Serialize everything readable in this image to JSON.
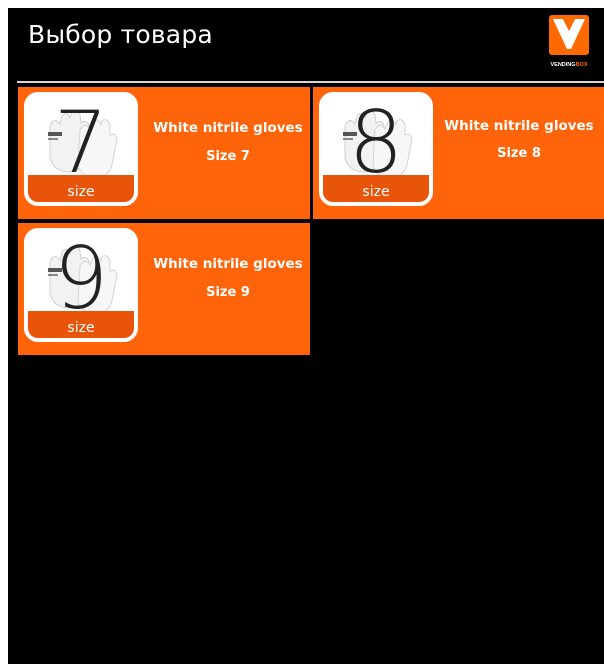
{
  "header": {
    "title": "Выбор товара",
    "logo": {
      "icon": "vendingbox-logo-icon",
      "text_primary": "VENDING",
      "text_accent": "BOX",
      "accent_color": "#ff6a00"
    }
  },
  "colors": {
    "background": "#000000",
    "card": "#ff640a",
    "card_band": "#e8550a",
    "text": "#ffffff"
  },
  "products": [
    {
      "size_number": "7",
      "size_word": "size",
      "name": "White nitrile gloves",
      "size_label": "Size 7",
      "image": "white-gloves-photo"
    },
    {
      "size_number": "8",
      "size_word": "size",
      "name": "White nitrile gloves",
      "size_label": "Size 8",
      "image": "white-gloves-photo"
    },
    {
      "size_number": "9",
      "size_word": "size",
      "name": "White nitrile gloves",
      "size_label": "Size 9",
      "image": "white-gloves-photo"
    }
  ]
}
